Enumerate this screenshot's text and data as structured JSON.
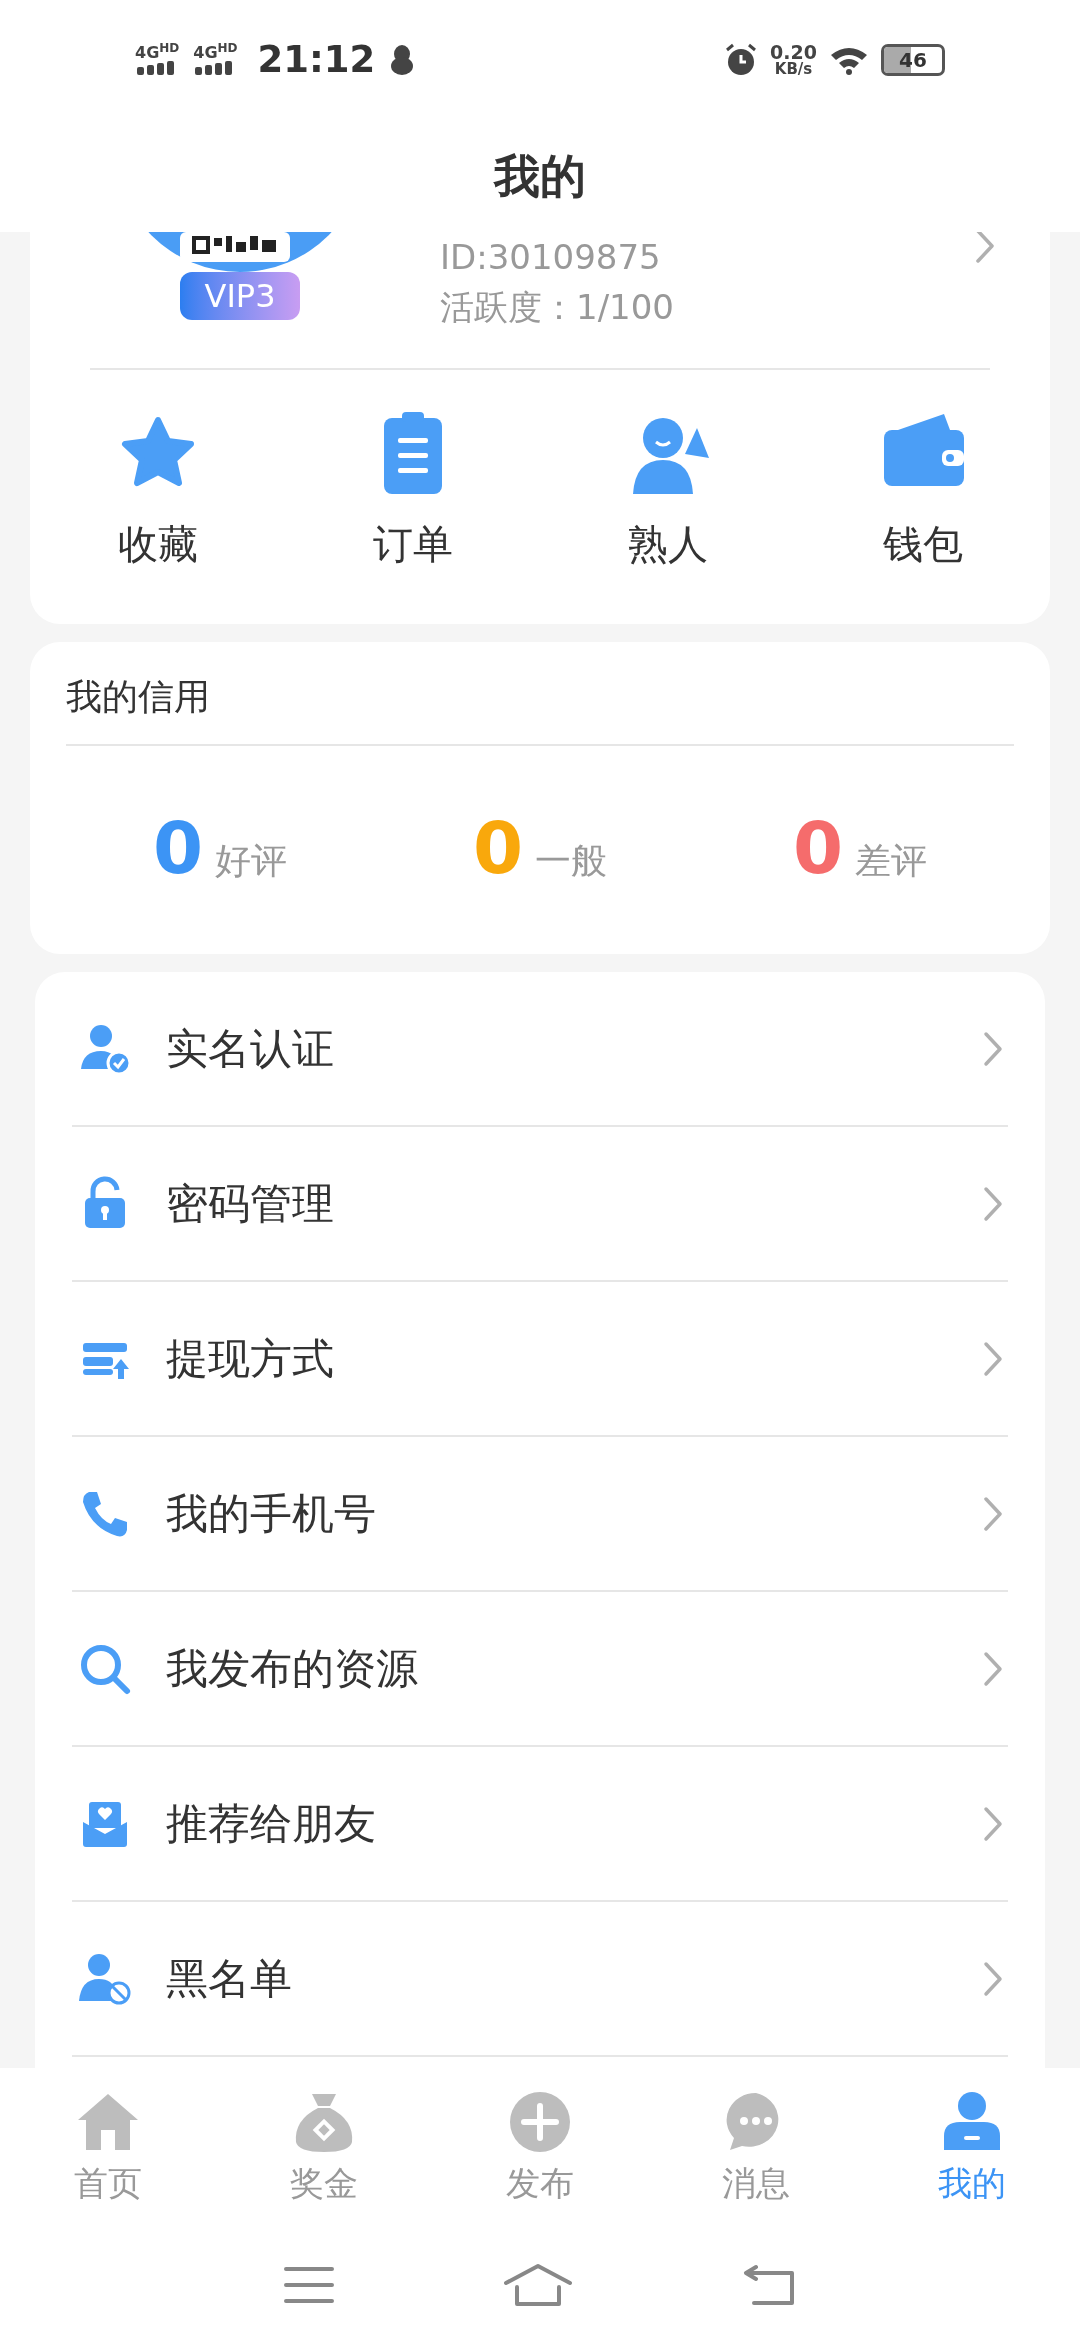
{
  "status_bar": {
    "networks": [
      "4G$^{HD}$",
      "4G$^{HD}$"
    ],
    "time": "21:12",
    "speed": "0.20",
    "speed_unit": "KB/s",
    "battery": "46"
  },
  "header": {
    "title": "我的"
  },
  "profile": {
    "vip": "VIP3",
    "id": "ID:30109875",
    "activity": "活跃度：1/100"
  },
  "shortcuts": [
    {
      "label": "收藏"
    },
    {
      "label": "订单"
    },
    {
      "label": "熟人"
    },
    {
      "label": "钱包"
    }
  ],
  "credit": {
    "title": "我的信用",
    "stats": [
      {
        "count": "0",
        "label": "好评",
        "color": "#3c94f5"
      },
      {
        "count": "0",
        "label": "一般",
        "color": "#f9a80c"
      },
      {
        "count": "0",
        "label": "差评",
        "color": "#f56c6c"
      }
    ]
  },
  "menu": [
    {
      "label": "实名认证"
    },
    {
      "label": "密码管理"
    },
    {
      "label": "提现方式"
    },
    {
      "label": "我的手机号"
    },
    {
      "label": "我发布的资源"
    },
    {
      "label": "推荐给朋友"
    },
    {
      "label": "黑名单"
    }
  ],
  "tabs": [
    {
      "label": "首页",
      "selected": false
    },
    {
      "label": "奖金",
      "selected": false
    },
    {
      "label": "发布",
      "selected": false
    },
    {
      "label": "消息",
      "selected": false
    },
    {
      "label": "我的",
      "selected": true
    }
  ]
}
